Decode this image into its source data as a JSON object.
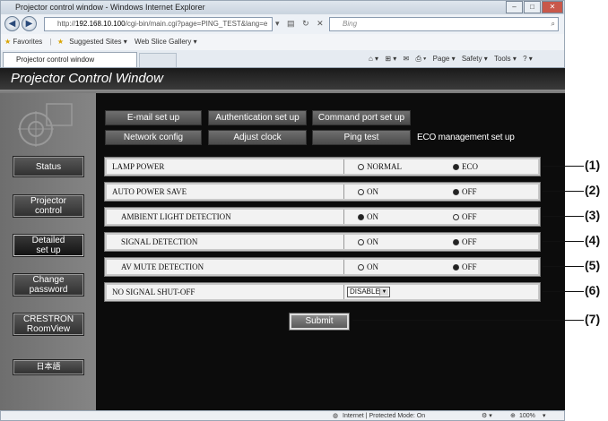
{
  "browser": {
    "window_title": "Projector control window - Windows Internet Explorer",
    "url_prefix": "http://",
    "url_host": "192.168.10.100",
    "url_path": "/cgi-bin/main.cgi?page=PING_TEST&lang=e",
    "search_placeholder": "Bing",
    "favorites_label": "Favorites",
    "suggested_sites": "Suggested Sites ▾",
    "web_slice_gallery": "Web Slice Gallery ▾",
    "tab_title": "Projector control window",
    "cmd_page": "Page ▾",
    "cmd_safety": "Safety ▾",
    "cmd_tools": "Tools ▾",
    "status_zone": "Internet | Protected Mode: On",
    "zoom": "100%"
  },
  "page": {
    "title": "Projector Control Window"
  },
  "sidebar": {
    "items": [
      {
        "label": "Status"
      },
      {
        "label": "Projector control"
      },
      {
        "label": "Detailed set up"
      },
      {
        "label": "Change password"
      },
      {
        "label": "CRESTRON RoomView"
      },
      {
        "label": "日本語"
      }
    ]
  },
  "tabs": {
    "email": "E-mail set up",
    "auth": "Authentication set up",
    "command_port": "Command port set up",
    "network": "Network config",
    "clock": "Adjust clock",
    "ping": "Ping test",
    "eco": "ECO management set up"
  },
  "settings": [
    {
      "label": "LAMP POWER",
      "opt1": "NORMAL",
      "opt2": "ECO",
      "selected": "ECO",
      "callout": "(1)"
    },
    {
      "label": "AUTO POWER SAVE",
      "opt1": "ON",
      "opt2": "OFF",
      "selected": "OFF",
      "callout": "(2)"
    },
    {
      "label": "AMBIENT LIGHT DETECTION",
      "opt1": "ON",
      "opt2": "OFF",
      "selected": "ON",
      "callout": "(3)"
    },
    {
      "label": "SIGNAL DETECTION",
      "opt1": "ON",
      "opt2": "OFF",
      "selected": "OFF",
      "callout": "(4)"
    },
    {
      "label": "AV MUTE DETECTION",
      "opt1": "ON",
      "opt2": "OFF",
      "selected": "OFF",
      "callout": "(5)"
    },
    {
      "label": "NO SIGNAL SHUT-OFF",
      "select_value": "DISABLE",
      "callout": "(6)"
    }
  ],
  "submit": {
    "label": "Submit",
    "callout": "(7)"
  }
}
